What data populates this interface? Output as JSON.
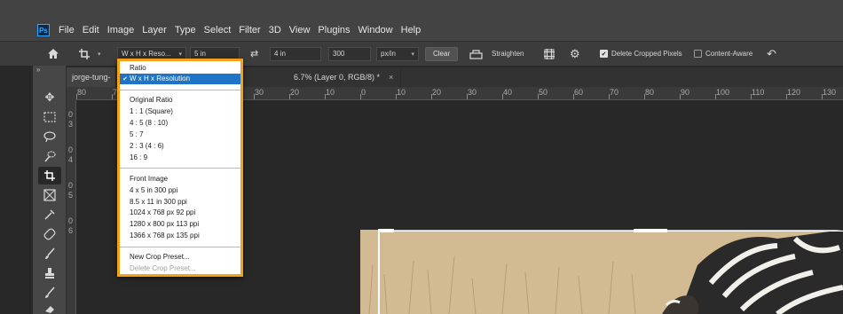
{
  "app": {
    "logo": "Ps"
  },
  "menu": [
    "File",
    "Edit",
    "Image",
    "Layer",
    "Type",
    "Select",
    "Filter",
    "3D",
    "View",
    "Plugins",
    "Window",
    "Help"
  ],
  "options": {
    "ratio_select": "W x H x Reso...",
    "width": "5 in",
    "height": "4 in",
    "resolution": "300",
    "unit": "px/in",
    "clear": "Clear",
    "straighten": "Straighten",
    "delete_cropped": "Delete Cropped Pixels",
    "content_aware": "Content-Aware",
    "delete_cropped_checked": true,
    "content_aware_checked": false
  },
  "tabs": [
    {
      "label": "jorge-tung-"
    },
    {
      "label": "6.7% (Layer 0, RGB/8) *",
      "close": "×"
    }
  ],
  "collapse": "»",
  "ruler_h": [
    "80",
    "70",
    "60",
    "50",
    "40",
    "30",
    "20",
    "10",
    "0",
    "10",
    "20",
    "30",
    "40",
    "50",
    "60",
    "70",
    "80",
    "90",
    "100",
    "110",
    "120",
    "130"
  ],
  "ruler_v": [
    "0",
    "3",
    "0",
    "4",
    "0",
    "5",
    "0",
    "6"
  ],
  "dropdown": {
    "items": [
      {
        "label": "Ratio",
        "type": "item"
      },
      {
        "label": "W x H x Resolution",
        "type": "selected",
        "check": "✔"
      },
      {
        "type": "sep"
      },
      {
        "label": "Original Ratio",
        "type": "item"
      },
      {
        "label": "1 : 1 (Square)",
        "type": "item"
      },
      {
        "label": "4 : 5 (8 : 10)",
        "type": "item"
      },
      {
        "label": "5 : 7",
        "type": "item"
      },
      {
        "label": "2 : 3 (4 : 6)",
        "type": "item"
      },
      {
        "label": "16 : 9",
        "type": "item"
      },
      {
        "type": "sep"
      },
      {
        "label": "Front Image",
        "type": "item"
      },
      {
        "label": "4 x 5 in 300 ppi",
        "type": "item"
      },
      {
        "label": "8.5 x 11 in 300 ppi",
        "type": "item"
      },
      {
        "label": "1024 x 768 px 92 ppi",
        "type": "item"
      },
      {
        "label": "1280 x 800 px 113 ppi",
        "type": "item"
      },
      {
        "label": "1366 x 768 px 135 ppi",
        "type": "item"
      },
      {
        "type": "sep"
      },
      {
        "label": "New Crop Preset...",
        "type": "item"
      },
      {
        "label": "Delete Crop Preset...",
        "type": "disabled"
      }
    ]
  },
  "colors": {
    "accent": "#f4a01b",
    "selection": "#1e74c6"
  }
}
